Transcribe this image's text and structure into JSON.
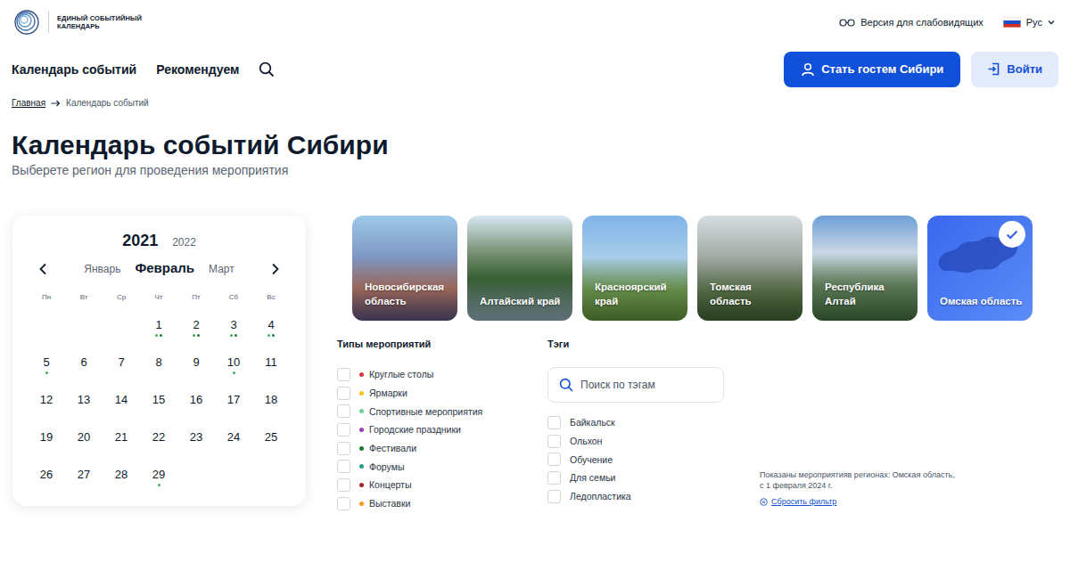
{
  "header": {
    "logo_lines": [
      "ЕДИНЫЙ СОБЫТИЙНЫЙ",
      "КАЛЕНДАРЬ"
    ],
    "accessibility": "Версия для слабовидящих",
    "language": "Рус"
  },
  "nav": {
    "items": [
      "Календарь событий",
      "Рекомендуем"
    ],
    "primary_button": "Стать гостем Сибири",
    "login_button": "Войти"
  },
  "breadcrumbs": [
    {
      "label": "Главная",
      "link": true
    },
    {
      "label": "Календарь событий",
      "link": false
    }
  ],
  "page": {
    "title": "Календарь событий Сибири",
    "subtitle": "Выберете регион для проведения мероприятия"
  },
  "calendar": {
    "years": [
      {
        "label": "2021",
        "selected": true
      },
      {
        "label": "2022",
        "selected": false
      }
    ],
    "months": [
      {
        "label": "Январь",
        "selected": false
      },
      {
        "label": "Февраль",
        "selected": true
      },
      {
        "label": "Март",
        "selected": false
      }
    ],
    "weekdays": [
      "Пн",
      "Вт",
      "Ср",
      "Чт",
      "Пт",
      "Сб",
      "Вс"
    ],
    "weeks": [
      [
        {
          "day": "",
          "dots": []
        },
        {
          "day": "",
          "dots": []
        },
        {
          "day": "",
          "dots": []
        },
        {
          "day": "1",
          "dots": [
            "#3fae5a",
            "#1f7a3a"
          ]
        },
        {
          "day": "2",
          "dots": [
            "#3fae5a",
            "#1f7a3a"
          ]
        },
        {
          "day": "3",
          "dots": [
            "#3fae5a",
            "#1f7a3a"
          ]
        },
        {
          "day": "4",
          "dots": [
            "#3fae5a",
            "#1f7a3a"
          ]
        }
      ],
      [
        {
          "day": "5",
          "dots": [
            "#3fae5a"
          ]
        },
        {
          "day": "6",
          "dots": []
        },
        {
          "day": "7",
          "dots": []
        },
        {
          "day": "8",
          "dots": []
        },
        {
          "day": "9",
          "dots": []
        },
        {
          "day": "10",
          "dots": [
            "#3fae5a"
          ]
        },
        {
          "day": "11",
          "dots": []
        }
      ],
      [
        {
          "day": "12",
          "dots": []
        },
        {
          "day": "13",
          "dots": []
        },
        {
          "day": "14",
          "dots": []
        },
        {
          "day": "15",
          "dots": []
        },
        {
          "day": "16",
          "dots": []
        },
        {
          "day": "17",
          "dots": []
        },
        {
          "day": "18",
          "dots": []
        }
      ],
      [
        {
          "day": "19",
          "dots": []
        },
        {
          "day": "20",
          "dots": []
        },
        {
          "day": "21",
          "dots": []
        },
        {
          "day": "22",
          "dots": []
        },
        {
          "day": "23",
          "dots": []
        },
        {
          "day": "24",
          "dots": []
        },
        {
          "day": "25",
          "dots": []
        }
      ],
      [
        {
          "day": "26",
          "dots": []
        },
        {
          "day": "27",
          "dots": []
        },
        {
          "day": "28",
          "dots": []
        },
        {
          "day": "29",
          "dots": [
            "#3fae5a"
          ]
        }
      ]
    ]
  },
  "regions": [
    {
      "name": "Новосибирская область",
      "selected": false
    },
    {
      "name": "Алтайский край",
      "selected": false
    },
    {
      "name": "Красноярский край",
      "selected": false
    },
    {
      "name": "Томская область",
      "selected": false
    },
    {
      "name": "Республика Алтай",
      "selected": false
    },
    {
      "name": "Омская область",
      "selected": true
    }
  ],
  "event_types": {
    "title": "Типы мероприятий",
    "items": [
      {
        "label": "Круглые столы",
        "color": "#d9363e",
        "checked": false
      },
      {
        "label": "Ярмарки",
        "color": "#f2c318",
        "checked": false
      },
      {
        "label": "Спортивные мероприятия",
        "color": "#6fcf97",
        "checked": false
      },
      {
        "label": "Городские праздники",
        "color": "#9b3fb5",
        "checked": false
      },
      {
        "label": "Фестивали",
        "color": "#1e7b2e",
        "checked": false
      },
      {
        "label": "Форумы",
        "color": "#2a9d8f",
        "checked": false
      },
      {
        "label": "Концерты",
        "color": "#a3242a",
        "checked": false
      },
      {
        "label": "Выставки",
        "color": "#f39c12",
        "checked": false
      }
    ]
  },
  "tags": {
    "title": "Тэги",
    "placeholder": "Поиск по тэгам",
    "items": [
      {
        "label": "Байкальск",
        "checked": false
      },
      {
        "label": "Ольхон",
        "checked": false
      },
      {
        "label": "Обучение",
        "checked": false
      },
      {
        "label": "Для семьи",
        "checked": false
      },
      {
        "label": "Ледопластика",
        "checked": false
      }
    ]
  },
  "summary": {
    "lines": [
      "Показаны мероприятияв регионах: Омская область,",
      "с 1 февраля 2024 г."
    ],
    "reset": "Сбросить фильтр"
  }
}
